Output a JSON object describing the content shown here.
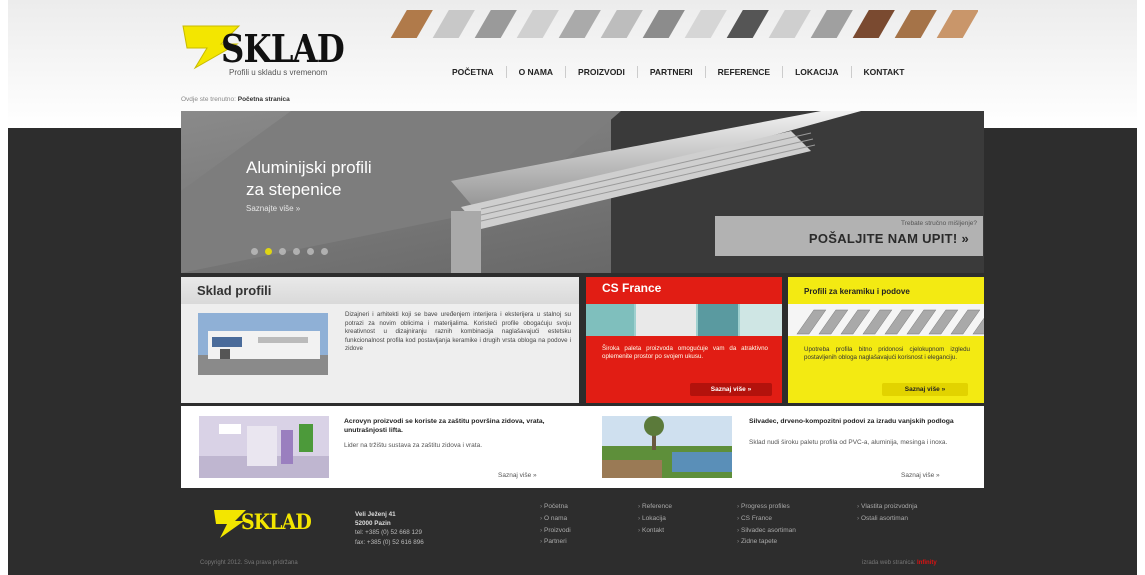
{
  "logo": {
    "text": "SKLAD",
    "tagline": "Profili u skladu s vremenom"
  },
  "nav": [
    "POČETNA",
    "O NAMA",
    "PROIZVODI",
    "PARTNERI",
    "REFERENCE",
    "LOKACIJA",
    "KONTAKT"
  ],
  "breadcrumb": {
    "prefix": "Ovdje ste trenutno:",
    "current": "Početna stranica"
  },
  "slider": {
    "title_line1": "Aluminijski profili",
    "title_line2": "za stepenice",
    "more": "Saznajte više »",
    "dots": 6,
    "active_dot": 1,
    "inquiry_small": "Trebate stručno mišljenje?",
    "inquiry_big": "POŠALJITE NAM UPIT! »"
  },
  "card_profili": {
    "title": "Sklad profili",
    "text": "Dizajneri i arhitekti koji se bave uređenjem interijera i eksterijera u stalnoj su potrazi za novim oblicima i materijalima. Koristeći profile obogaćuju svoju kreativnost u dizajniranju raznih kombinacija naglašavajući estetsku funkcionalnost profila kod postavljanja keramike i drugih vrsta obloga na podove i zidove"
  },
  "card_csfrance": {
    "title": "CS France",
    "text": "Široka paleta proizvoda omogućuje vam da atraktivno oplemenite prostor po svojem ukusu.",
    "button": "Saznaj više »"
  },
  "card_keramika": {
    "title": "Profili za keramiku i podove",
    "text": "Upotreba profila bitno pridonosi cjelokupnom izgledu postavljenih obloga naglašavajući korisnost i eleganciju.",
    "button": "Saznaj više »"
  },
  "acrovyn": {
    "title": "Acrovyn proizvodi se koriste za zaštitu površina zidova, vrata, unutrašnjosti lifta.",
    "text": "Lider na tržištu sustava za zaštitu zidova i vrata.",
    "more": "Saznaj više »"
  },
  "silvadec": {
    "title": "Silvadec, drveno-kompozitni podovi za izradu vanjskih podloga",
    "text": "Sklad nudi široku paletu profila od PVC-a, aluminija, mesinga i inoxa.",
    "more": "Saznaj više »"
  },
  "footer": {
    "logo": "SKLAD",
    "address": [
      "Veli Ježenj 41",
      "52000 Pazin",
      "tel: +385 (0) 52 668 129",
      "fax: +385 (0) 52 616 896"
    ],
    "col1": [
      "Početna",
      "O nama",
      "Proizvodi",
      "Partneri"
    ],
    "col2": [
      "Reference",
      "Lokacija",
      "Kontakt"
    ],
    "col3": [
      "Progress profiles",
      "CS France",
      "Silvadec asortiman",
      "Zidne tapete"
    ],
    "col4": [
      "Vlastita proizvodnja",
      "Ostali asortiman"
    ],
    "copyright": "Copyright 2012. Sva prava pridržana",
    "credit_prefix": "izrada web stranica:",
    "credit_brand": "Infinity"
  },
  "colors": {
    "brand_yellow": "#f3e600",
    "red": "#e11d14",
    "dark": "#2d2d2d"
  }
}
